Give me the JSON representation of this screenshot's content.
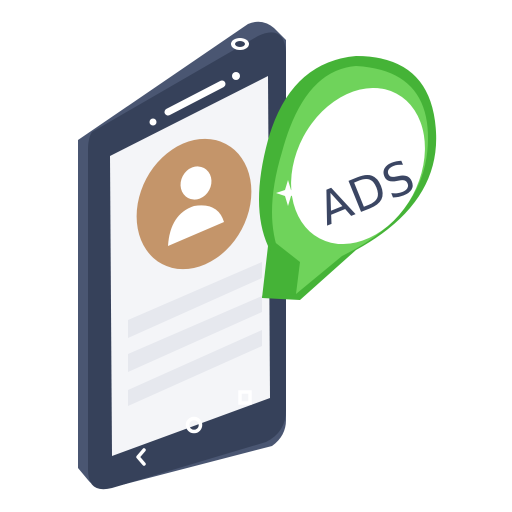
{
  "illustration": {
    "subject": "smartphone-with-ads-bubble",
    "badge_text": "ADS",
    "icons": {
      "profile": "user-avatar-icon",
      "back": "nav-back-icon",
      "home": "nav-home-icon",
      "recents": "nav-recents-icon",
      "sparkle": "sparkle-icon"
    },
    "colors": {
      "phone_body": "#36415a",
      "phone_side": "#4a5672",
      "screen": "#f4f5f8",
      "avatar_bg": "#c4956a",
      "avatar_fg": "#ffffff",
      "text_lines": "#e6e8ee",
      "bubble_light": "#6fd35b",
      "bubble_dark": "#45b337",
      "bubble_inner": "#ffffff",
      "ads_text": "#3b4663"
    }
  }
}
